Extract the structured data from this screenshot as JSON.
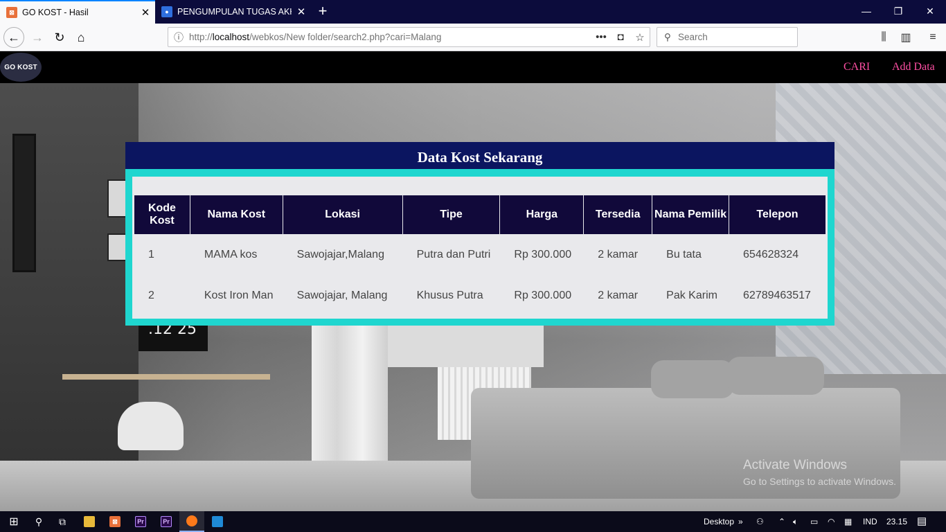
{
  "browser": {
    "tabs": [
      {
        "title": "GO KOST - Hasil",
        "active": true
      },
      {
        "title": "PENGUMPULAN TUGAS AKHIR",
        "active": false
      }
    ],
    "url_prefix": "http://",
    "url_host": "localhost",
    "url_path": "/webkos/New folder/search2.php?cari=Malang",
    "search_placeholder": "Search",
    "page_actions": "•••"
  },
  "site": {
    "logo": "GO KOST",
    "nav": [
      {
        "label": "CARI"
      },
      {
        "label": "Add Data"
      }
    ]
  },
  "panel": {
    "title": "Data Kost Sekarang"
  },
  "table": {
    "headers": [
      "Kode Kost",
      "Nama Kost",
      "Lokasi",
      "Tipe",
      "Harga",
      "Tersedia",
      "Nama Pemilik",
      "Telepon"
    ],
    "rows": [
      [
        "1",
        "MAMA kos",
        "Sawojajar,Malang",
        "Putra dan Putri",
        "Rp 300.000",
        "2 kamar",
        "Bu tata",
        "654628324"
      ],
      [
        "2",
        "Kost Iron Man",
        "Sawojajar, Malang",
        "Khusus Putra",
        "Rp 300.000",
        "2 kamar",
        "Pak Karim",
        "62789463517"
      ]
    ]
  },
  "watermark": {
    "line1": "Activate Windows",
    "line2": "Go to Settings to activate Windows."
  },
  "taskbar": {
    "desktop_label": "Desktop",
    "language": "IND",
    "time": "23.15"
  },
  "colors": {
    "accent_tab": "#0a84ff",
    "nav_link": "#ff4fa3",
    "panel_border": "#1fd6cf",
    "panel_title_bg": "#0b1560",
    "table_header_bg": "#11093a"
  }
}
